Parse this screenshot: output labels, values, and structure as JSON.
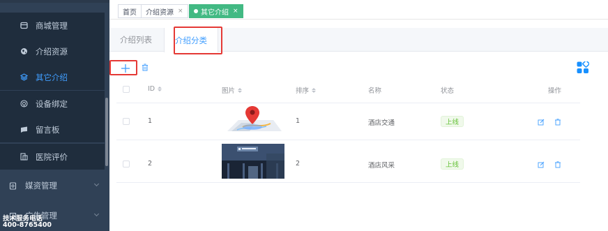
{
  "sidebar": {
    "items": [
      {
        "label": "商城管理",
        "icon": "shop-icon",
        "active": false
      },
      {
        "label": "介绍资源",
        "icon": "globe-icon",
        "active": false
      },
      {
        "label": "其它介绍",
        "icon": "layers-icon",
        "active": true
      },
      {
        "label": "设备绑定",
        "icon": "device-icon",
        "active": false
      },
      {
        "label": "留言板",
        "icon": "message-icon",
        "active": false
      },
      {
        "label": "医院评价",
        "icon": "comment-icon",
        "active": false
      }
    ],
    "groups": [
      {
        "label": "媒资管理",
        "icon": "media-icon"
      },
      {
        "label": "广告管理",
        "icon": "ad-icon"
      }
    ],
    "footer": {
      "line1": "技术服务电话",
      "line2": "400-8765400"
    }
  },
  "tags": [
    {
      "label": "首页",
      "closable": false,
      "active": false
    },
    {
      "label": "介绍资源",
      "closable": true,
      "active": false
    },
    {
      "label": "其它介绍",
      "closable": true,
      "active": true
    }
  ],
  "tabs": [
    {
      "label": "介绍列表",
      "active": false
    },
    {
      "label": "介绍分类",
      "active": true
    }
  ],
  "toolbar": {
    "add_icon": "plus-icon",
    "delete_icon": "trash-icon",
    "columns_icon": "grid-icon"
  },
  "table": {
    "columns": [
      "ID",
      "图片",
      "排序",
      "名称",
      "状态",
      "操作"
    ],
    "rows": [
      {
        "id": "1",
        "sort": "1",
        "name": "酒店交通",
        "status": "上线",
        "image": "map-pin-illustration"
      },
      {
        "id": "2",
        "sort": "2",
        "name": "酒店风采",
        "status": "上线",
        "image": "hotel-photo"
      }
    ]
  },
  "colors": {
    "sidebar_bg": "#304156",
    "active_blue": "#409eff",
    "tag_green": "#42b983",
    "status_green": "#67c23a",
    "highlight_red": "#e53935"
  }
}
